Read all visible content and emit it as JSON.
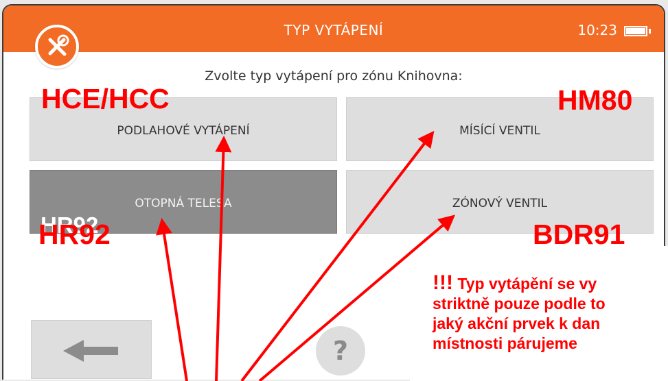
{
  "header": {
    "title": "TYP VYTÁPENÍ",
    "time": "10:23"
  },
  "icons": {
    "settings": "tools-icon",
    "battery": "battery-icon",
    "back": "back-arrow-icon",
    "help": "help-icon"
  },
  "prompt": "Zvolte typ vytápení pro zónu Knihovna:",
  "options": [
    {
      "label": "PODLAHOVÉ VYTÁPENÍ",
      "selected": false
    },
    {
      "label": "MÍSÍCÍ VENTIL",
      "selected": false
    },
    {
      "label": "OTOPNÁ TELESA",
      "selected": true
    },
    {
      "label": "ZÓNOVÝ VENTIL",
      "selected": false
    }
  ],
  "overlay_labels": {
    "top_left": "HCE/HCC",
    "top_right": "HM80",
    "bottom_left": "HR92",
    "bottom_right": "BDR91",
    "ghost": "HR92"
  },
  "help_label": "?",
  "note": {
    "bang": "!!!",
    "line1": " Typ vytápění se vy",
    "line2": "striktně pouze podle to",
    "line3": "jaký akční prvek k dan",
    "line4": "místnosti párujeme"
  },
  "colors": {
    "header": "#f26c26",
    "tile": "#dedede",
    "tile_selected": "#8c8c8c",
    "annotation": "#ff0000"
  }
}
